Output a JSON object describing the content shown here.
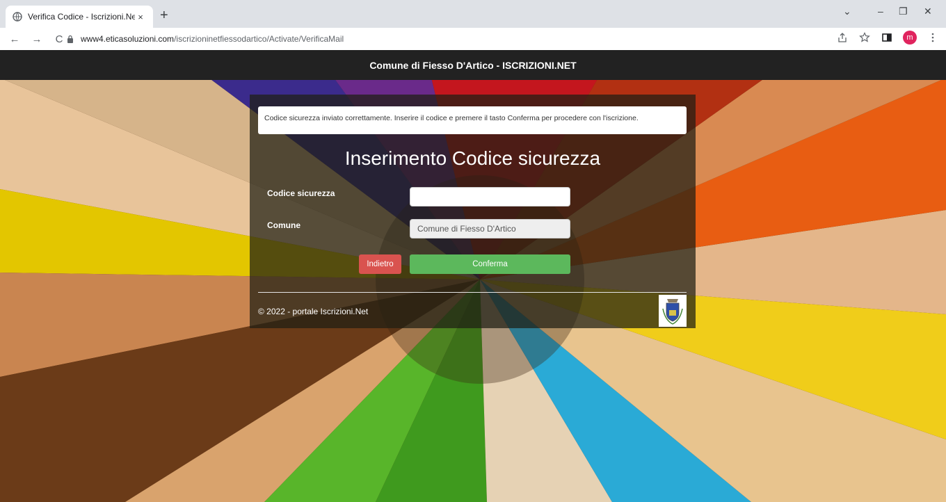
{
  "browser": {
    "tab_title": "Verifica Codice - Iscrizioni.Net",
    "tab_close": "×",
    "new_tab": "+",
    "url_host": "www4.eticasoluzioni.com",
    "url_path": "/iscrizioninetfiessodartico/Activate/VerificaMail",
    "profile_initial": "m",
    "window_controls": [
      "⌄",
      "–",
      "❐",
      "✕"
    ],
    "nav": [
      "←",
      "→",
      "C"
    ],
    "toolbar_icons": [
      "share-icon",
      "star-icon",
      "sidepanel-icon",
      "menu-icon"
    ]
  },
  "navbar": {
    "title": "Comune di Fiesso D'Artico - ISCRIZIONI.NET"
  },
  "alert": {
    "message": "Codice sicurezza inviato correttamente. Inserire il codice e premere il tasto Conferma per procedere con l'iscrizione."
  },
  "form": {
    "heading": "Inserimento Codice sicurezza",
    "code_label": "Codice sicurezza",
    "code_value": "",
    "comune_label": "Comune",
    "comune_value": "Comune di Fiesso D'Artico",
    "back_label": "Indietro",
    "confirm_label": "Conferma"
  },
  "footer": {
    "text": "© 2022 - portale Iscrizioni.Net"
  },
  "colors": {
    "navbar_bg": "#222222",
    "danger": "#d9534f",
    "success": "#5cb85c",
    "avatar": "#e0245e"
  }
}
